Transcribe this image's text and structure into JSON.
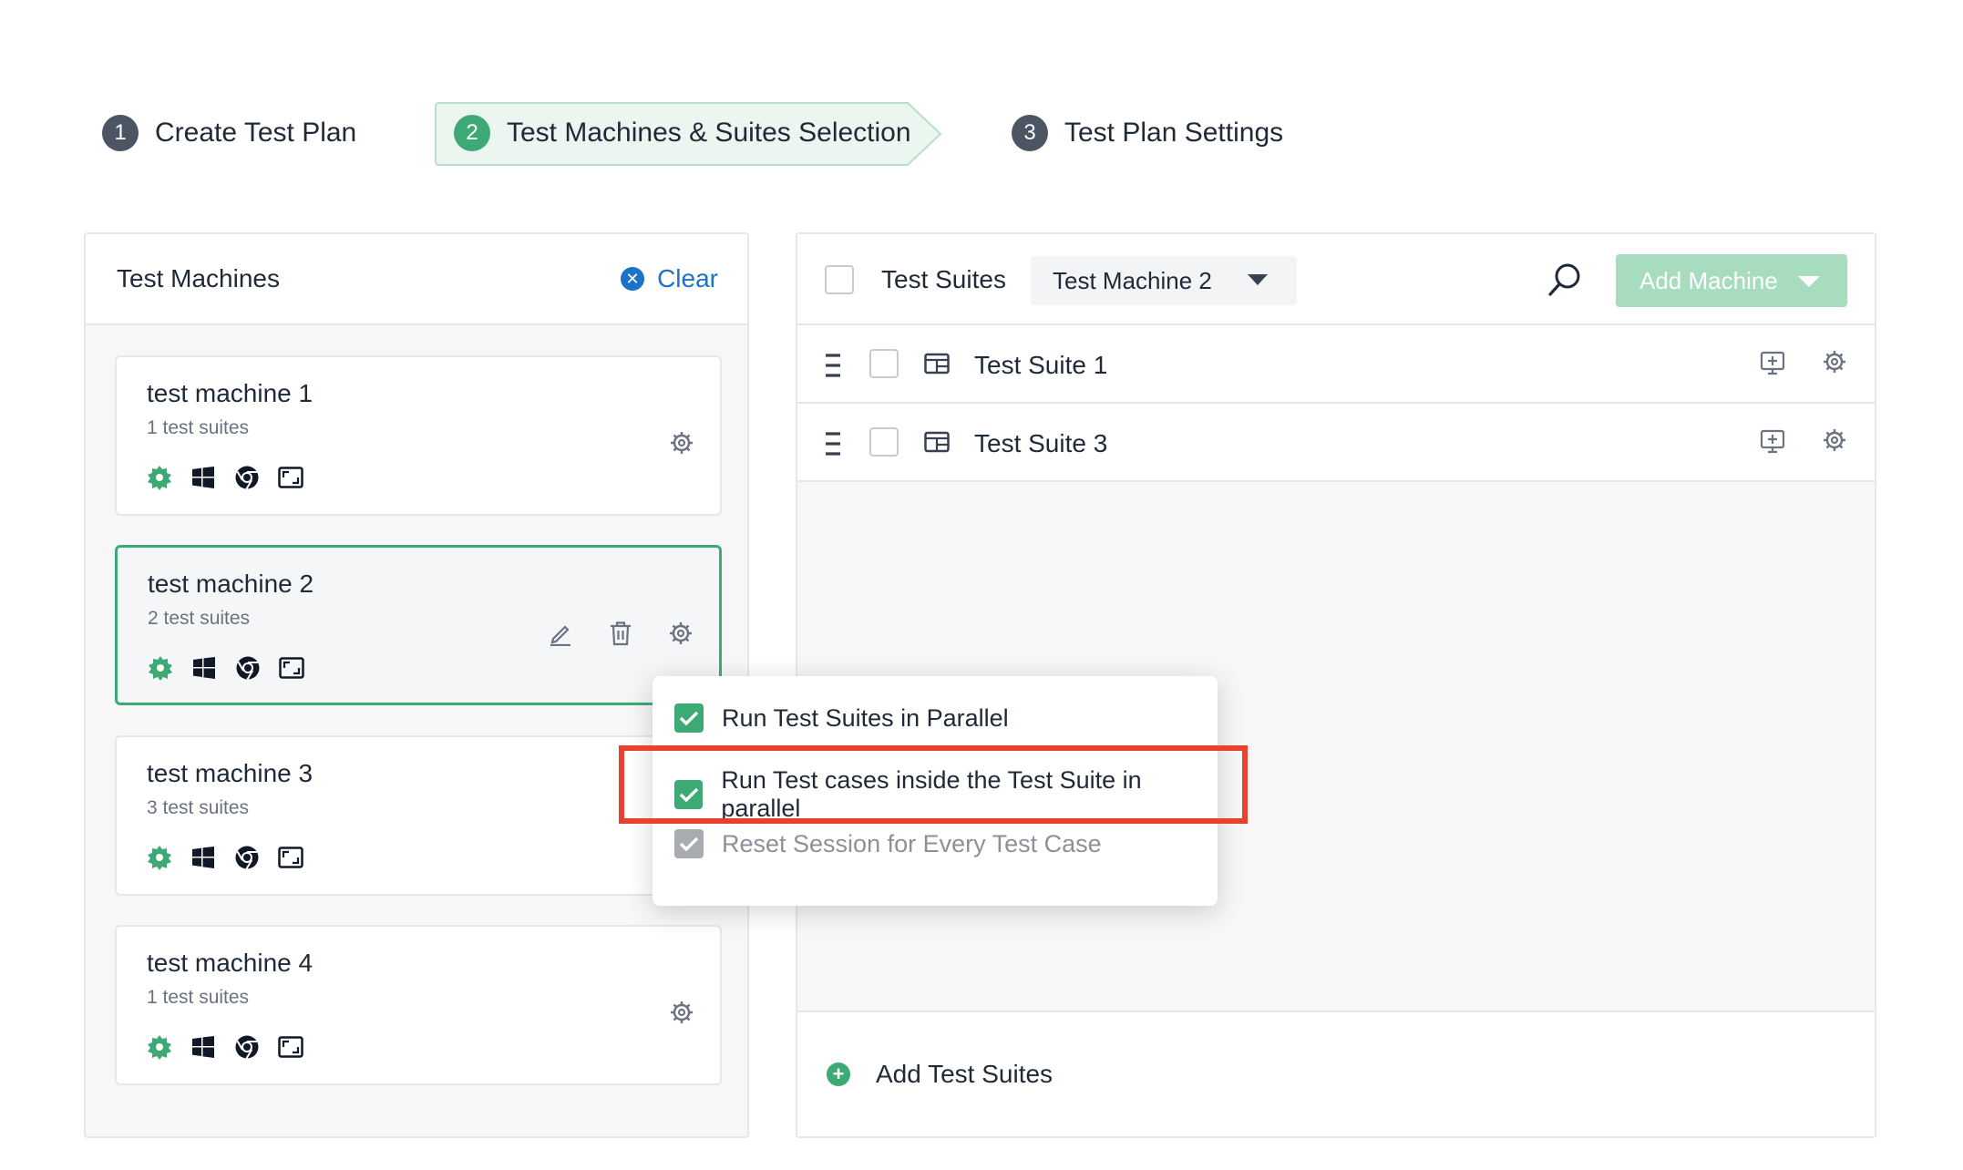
{
  "stepper": {
    "steps": [
      {
        "num": "1",
        "label": "Create Test Plan"
      },
      {
        "num": "2",
        "label": "Test Machines & Suites Selection"
      },
      {
        "num": "3",
        "label": "Test Plan Settings"
      }
    ],
    "active_step": 2
  },
  "left_panel": {
    "title": "Test Machines",
    "clear_label": "Clear",
    "machines": [
      {
        "name": "test machine 1",
        "suites": "1 test suites",
        "selected": false
      },
      {
        "name": "test machine 2",
        "suites": "2 test suites",
        "selected": true
      },
      {
        "name": "test machine 3",
        "suites": "3 test suites",
        "selected": false
      },
      {
        "name": "test machine 4",
        "suites": "1 test suites",
        "selected": false
      }
    ],
    "machine_icons": [
      "settings-badge-icon",
      "windows-icon",
      "chrome-icon",
      "screen-resolution-icon"
    ]
  },
  "right_panel": {
    "title": "Test Suites",
    "machine_select": "Test Machine 2",
    "add_machine_label": "Add Machine",
    "suites": [
      {
        "name": "Test Suite 1"
      },
      {
        "name": "Test Suite 3"
      }
    ],
    "add_suites_label": "Add Test Suites"
  },
  "popup": {
    "options": [
      {
        "label": "Run Test Suites in Parallel",
        "checked": true,
        "disabled": false
      },
      {
        "label": "Run Test cases inside the Test Suite in parallel",
        "checked": true,
        "disabled": false,
        "highlighted": true
      },
      {
        "label": "Reset Session for Every Test Case",
        "checked": true,
        "disabled": true
      }
    ]
  },
  "colors": {
    "accent": "#3daa75",
    "link": "#1a73c8",
    "highlight": "#e8412f",
    "add_machine_bg": "#a7dcbf"
  }
}
